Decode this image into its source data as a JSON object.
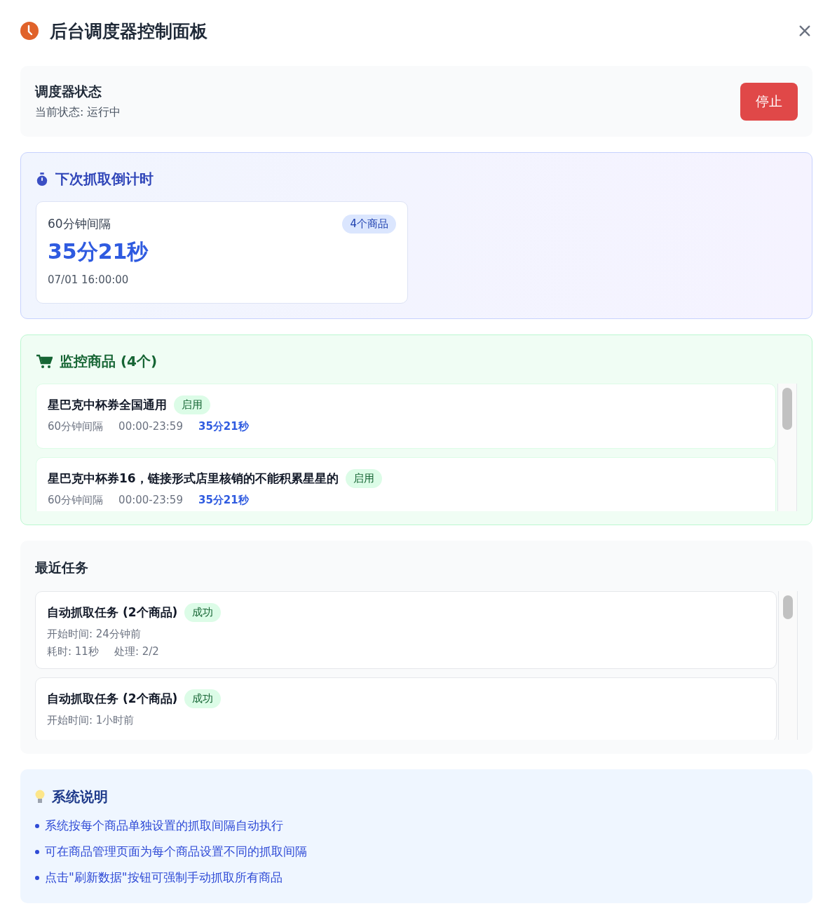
{
  "window": {
    "title": "后台调度器控制面板"
  },
  "status": {
    "title": "调度器状态",
    "text": "当前状态: 运行中",
    "running": true,
    "button": "停止"
  },
  "countdown": {
    "title": "下次抓取倒计时",
    "cards": [
      {
        "interval": "60分钟间隔",
        "badge": "4个商品",
        "remaining": "35分21秒",
        "time": "07/01 16:00:00"
      }
    ]
  },
  "products": {
    "title": "监控商品 (4个)",
    "items": [
      {
        "name": "星巴克中杯券全国通用",
        "status": "启用",
        "enabled": true,
        "interval": "60分钟间隔",
        "window": "00:00-23:59",
        "remaining": "35分21秒"
      },
      {
        "name": "星巴克中杯券16，链接形式店里核销的不能积累星星的",
        "status": "启用",
        "enabled": true,
        "interval": "60分钟间隔",
        "window": "00:00-23:59",
        "remaining": "35分21秒"
      }
    ]
  },
  "tasks": {
    "title": "最近任务",
    "items": [
      {
        "name": "自动抓取任务 (2个商品)",
        "status": "成功",
        "success": true,
        "start": "开始时间: 24分钟前",
        "duration": "耗时: 11秒",
        "processed": "处理: 2/2"
      },
      {
        "name": "自动抓取任务 (2个商品)",
        "status": "成功",
        "success": true,
        "start": "开始时间: 1小时前"
      }
    ]
  },
  "info": {
    "title": "系统说明",
    "items": [
      "系统按每个商品单独设置的抓取间隔自动执行",
      "可在商品管理页面为每个商品设置不同的抓取间隔",
      "点击\"刷新数据\"按钮可强制手动抓取所有商品"
    ]
  }
}
